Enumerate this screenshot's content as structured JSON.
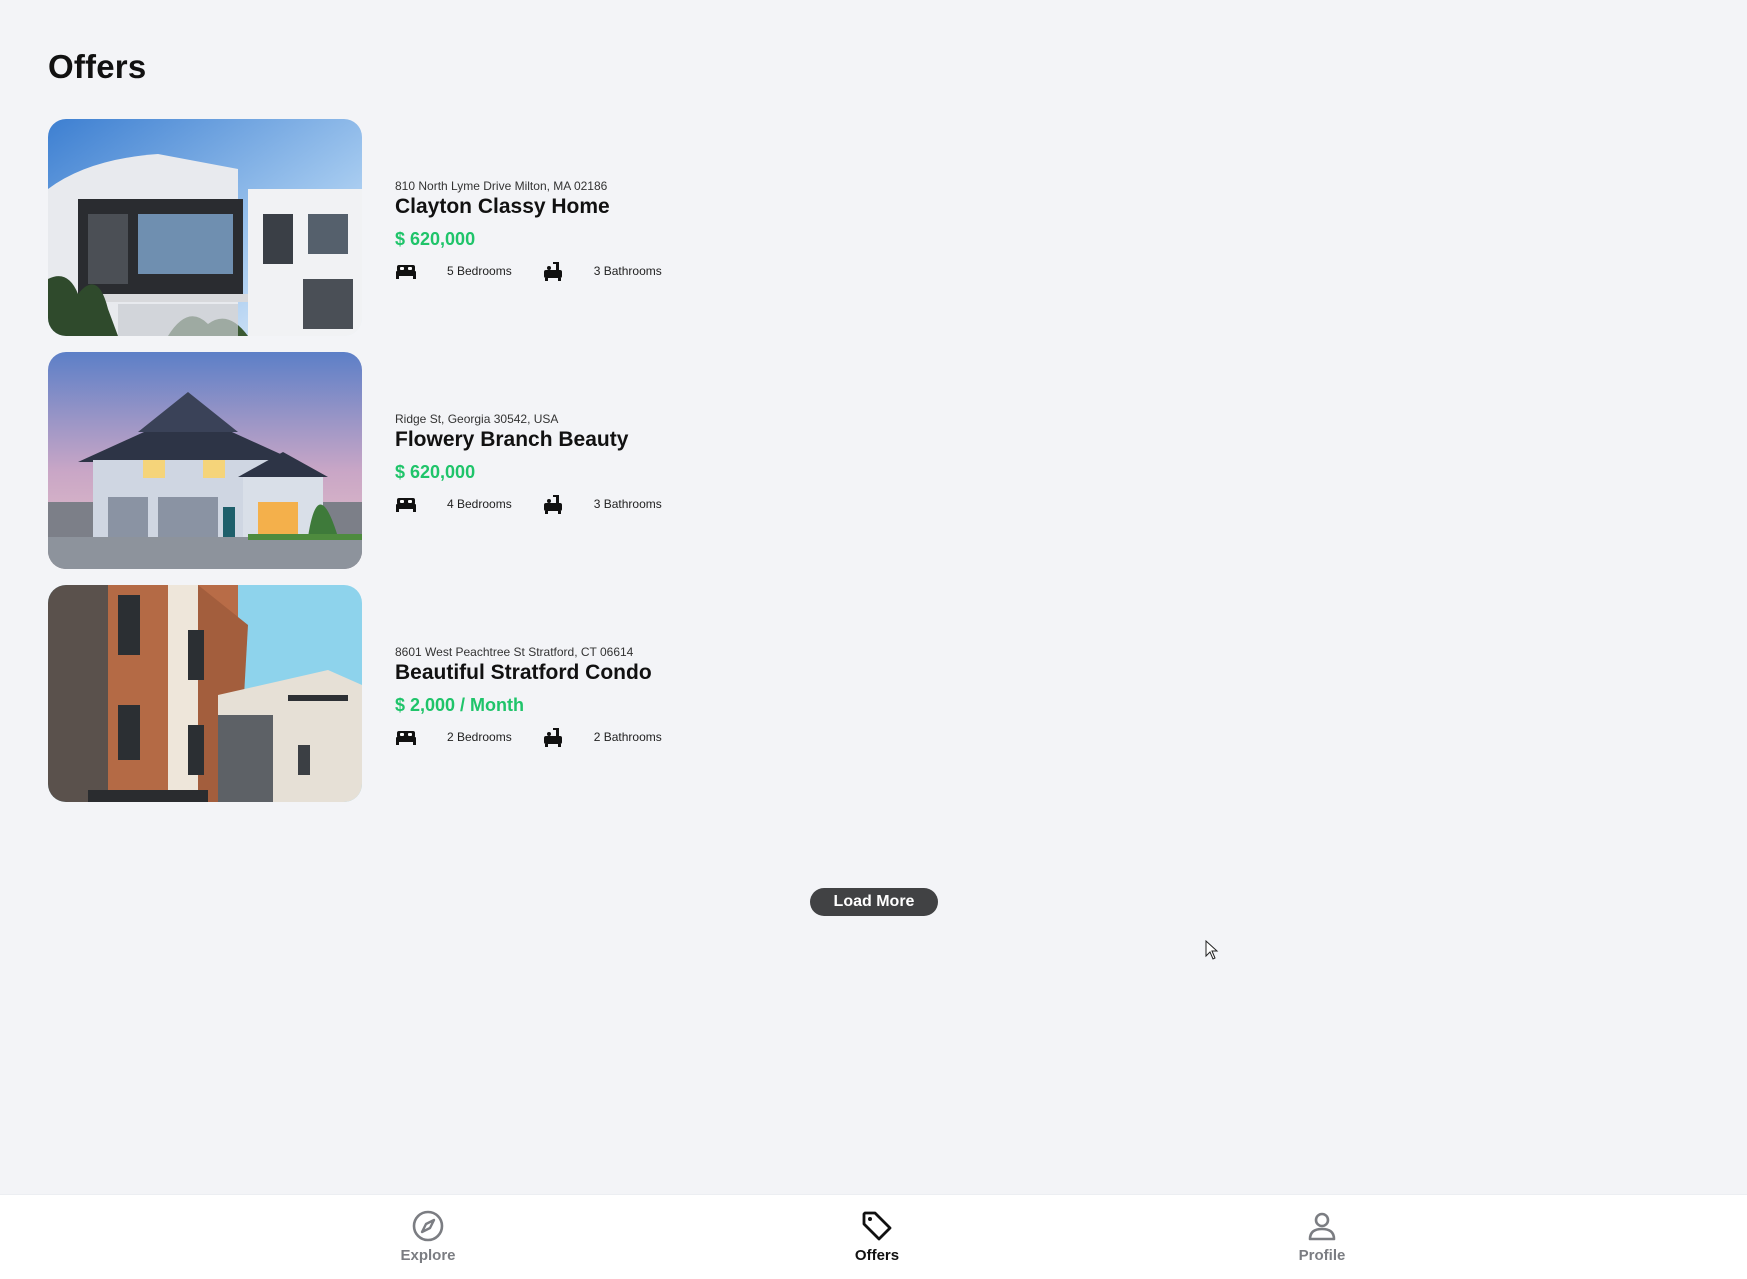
{
  "header": {
    "title": "Offers"
  },
  "offers": [
    {
      "address": "810 North Lyme Drive Milton, MA 02186",
      "name": "Clayton Classy Home",
      "price": "$ 620,000",
      "bedrooms": "5 Bedrooms",
      "bathrooms": "3 Bathrooms"
    },
    {
      "address": "Ridge St, Georgia 30542, USA",
      "name": "Flowery Branch Beauty",
      "price": "$ 620,000",
      "bedrooms": "4 Bedrooms",
      "bathrooms": "3 Bathrooms"
    },
    {
      "address": "8601 West Peachtree St Stratford, CT 06614",
      "name": "Beautiful Stratford Condo",
      "price": "$ 2,000 / Month",
      "bedrooms": "2 Bedrooms",
      "bathrooms": "2 Bathrooms"
    }
  ],
  "load_more": {
    "label": "Load More"
  },
  "tabbar": {
    "tabs": [
      {
        "label": "Explore",
        "icon": "compass-icon",
        "active": false
      },
      {
        "label": "Offers",
        "icon": "tag-icon",
        "active": true
      },
      {
        "label": "Profile",
        "icon": "person-icon",
        "active": false
      }
    ]
  },
  "colors": {
    "background": "#f3f4f7",
    "price": "#1fc46a",
    "button": "#414244",
    "tab_inactive": "#7b7d82"
  }
}
